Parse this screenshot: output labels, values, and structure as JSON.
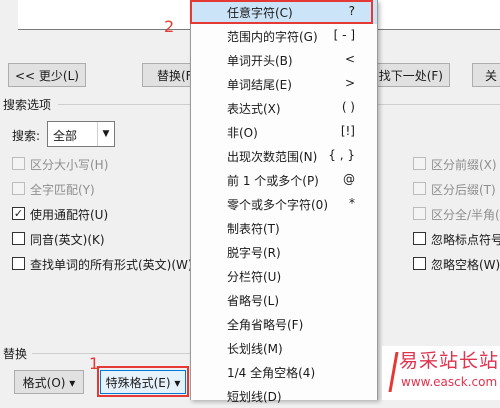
{
  "top_buttons": {
    "less": "<< 更少(L)",
    "replace": "替换(F",
    "find_next": "找下一处(F)",
    "close": "关"
  },
  "search_options": {
    "title": "搜索选项",
    "search_label": "搜索:",
    "search_value": "全部",
    "left_options": [
      {
        "label": "区分大小写(H)",
        "checked": false,
        "disabled": true
      },
      {
        "label": "全字匹配(Y)",
        "checked": false,
        "disabled": true
      },
      {
        "label": "使用通配符(U)",
        "checked": true,
        "disabled": false
      },
      {
        "label": "同音(英文)(K)",
        "checked": false,
        "disabled": false
      },
      {
        "label": "查找单词的所有形式(英文)(W)",
        "checked": false,
        "disabled": false
      }
    ],
    "right_options": [
      {
        "label": "区分前缀(X)",
        "checked": false,
        "disabled": true
      },
      {
        "label": "区分后缀(T)",
        "checked": false,
        "disabled": true
      },
      {
        "label": "区分全/半角(",
        "checked": false,
        "disabled": true
      },
      {
        "label": "忽略标点符号",
        "checked": false,
        "disabled": false
      },
      {
        "label": "忽略空格(W)",
        "checked": false,
        "disabled": false
      }
    ]
  },
  "replace_section": {
    "title": "替换",
    "format_button": "格式(O) ▾",
    "special_button": "特殊格式(E) ▾"
  },
  "menu": {
    "items": [
      {
        "label": "任意字符(C)",
        "shortcut": "?"
      },
      {
        "label": "范围内的字符(G)",
        "shortcut": "[ - ]"
      },
      {
        "label": "单词开头(B)",
        "shortcut": "<"
      },
      {
        "label": "单词结尾(E)",
        "shortcut": ">"
      },
      {
        "label": "表达式(X)",
        "shortcut": "( )"
      },
      {
        "label": "非(O)",
        "shortcut": "[!]"
      },
      {
        "label": "出现次数范围(N)",
        "shortcut": "{ , }"
      },
      {
        "label": "前 1 个或多个(P)",
        "shortcut": "@"
      },
      {
        "label": "零个或多个字符(0)",
        "shortcut": "*"
      },
      {
        "label": "制表符(T)",
        "shortcut": ""
      },
      {
        "label": "脱字号(R)",
        "shortcut": ""
      },
      {
        "label": "分栏符(U)",
        "shortcut": ""
      },
      {
        "label": "省略号(L)",
        "shortcut": ""
      },
      {
        "label": "全角省略号(F)",
        "shortcut": ""
      },
      {
        "label": "长划线(M)",
        "shortcut": ""
      },
      {
        "label": "1/4 全角空格(4)",
        "shortcut": ""
      },
      {
        "label": "短划线(D)",
        "shortcut": ""
      }
    ]
  },
  "annotations": {
    "step1": "1",
    "step2": "2",
    "color": "#e53935"
  },
  "watermark": {
    "title": "易采站长站",
    "url": "www.easck.com"
  }
}
